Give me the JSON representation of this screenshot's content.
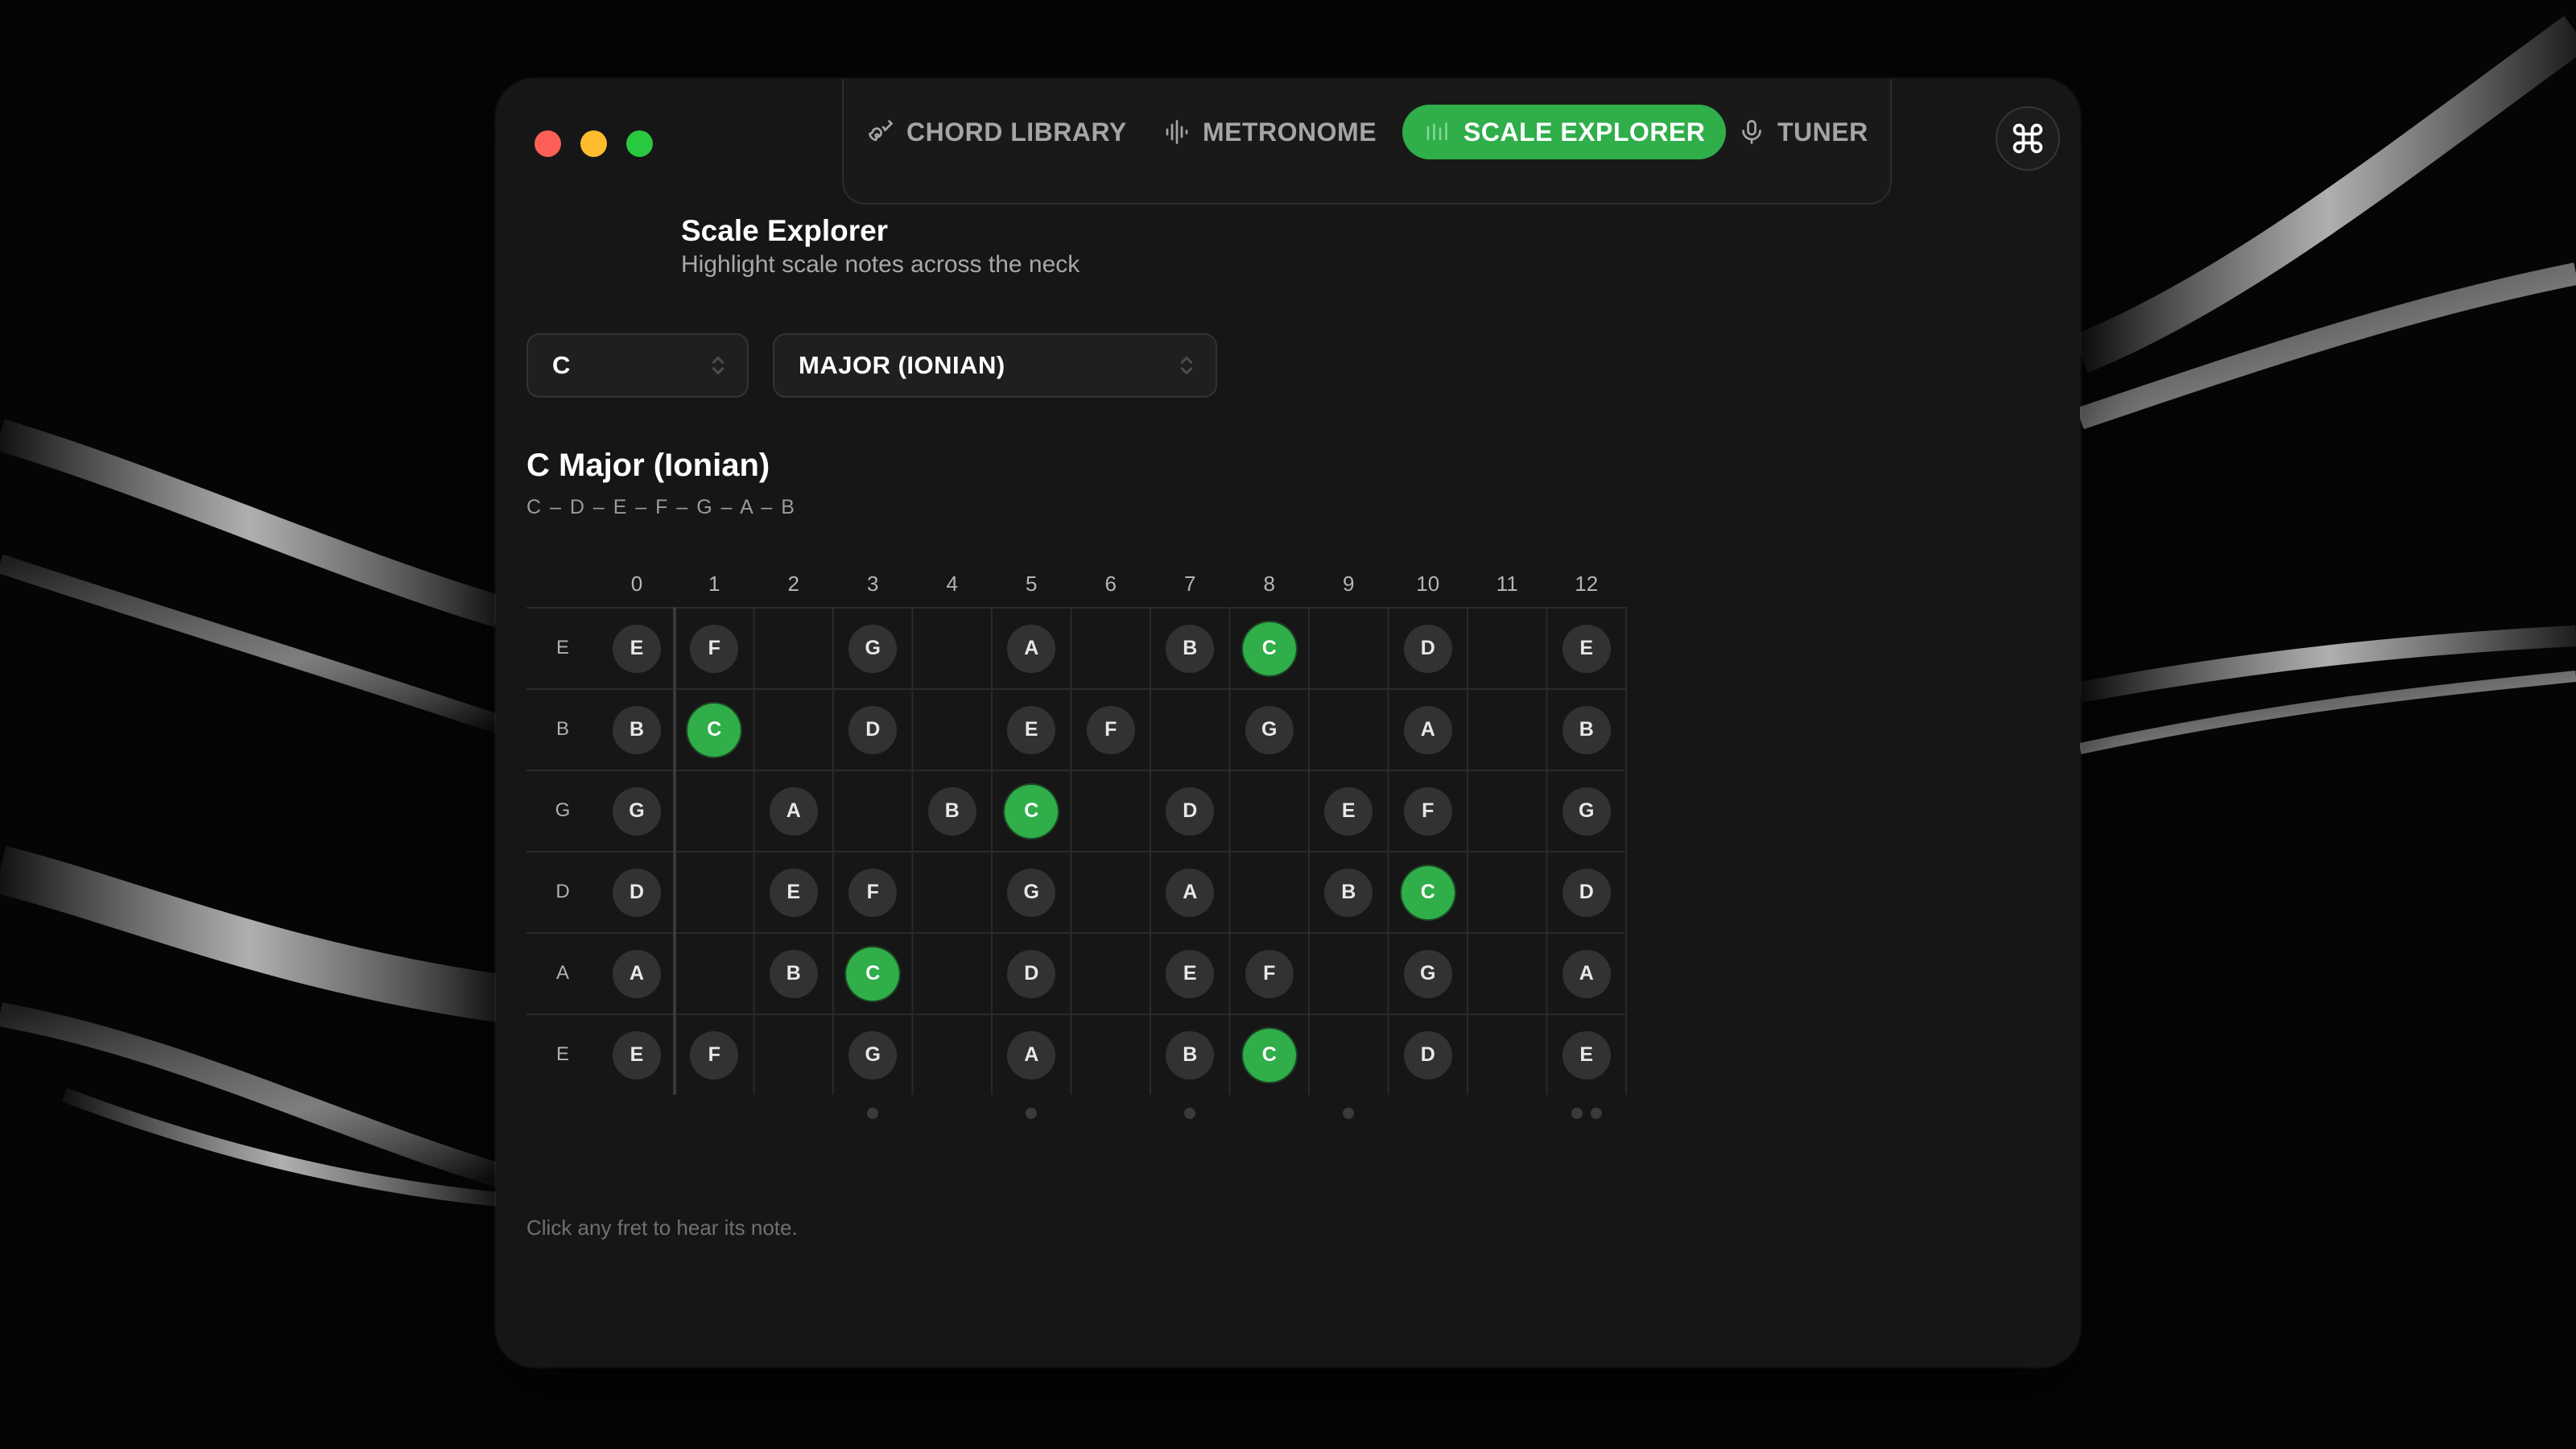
{
  "nav": {
    "tabs": [
      {
        "label": "CHORD LIBRARY",
        "icon": "guitar-icon"
      },
      {
        "label": "METRONOME",
        "icon": "waveform-icon"
      },
      {
        "label": "SCALE EXPLORER",
        "icon": "notes-icon",
        "active": true
      },
      {
        "label": "TUNER",
        "icon": "microphone-icon"
      }
    ],
    "command_icon": "command-key-icon"
  },
  "page": {
    "title": "Scale Explorer",
    "subtitle": "Highlight scale notes across the neck"
  },
  "controls": {
    "key": "C",
    "mode": "MAJOR (IONIAN)"
  },
  "scale": {
    "name": "C Major (Ionian)",
    "notes": "C – D – E – F – G – A – B"
  },
  "fretboard": {
    "frets": [
      "0",
      "1",
      "2",
      "3",
      "4",
      "5",
      "6",
      "7",
      "8",
      "9",
      "10",
      "11",
      "12"
    ],
    "strings": [
      {
        "label": "E",
        "notes": [
          "E",
          "F",
          "",
          "G",
          "",
          "A",
          "",
          "B",
          "C",
          "",
          "D",
          "",
          "E"
        ]
      },
      {
        "label": "B",
        "notes": [
          "B",
          "C",
          "",
          "D",
          "",
          "E",
          "F",
          "",
          "G",
          "",
          "A",
          "",
          "B"
        ]
      },
      {
        "label": "G",
        "notes": [
          "G",
          "",
          "A",
          "",
          "B",
          "C",
          "",
          "D",
          "",
          "E",
          "F",
          "",
          "G"
        ]
      },
      {
        "label": "D",
        "notes": [
          "D",
          "",
          "E",
          "F",
          "",
          "G",
          "",
          "A",
          "",
          "B",
          "C",
          "",
          "D"
        ]
      },
      {
        "label": "A",
        "notes": [
          "A",
          "",
          "B",
          "C",
          "",
          "D",
          "",
          "E",
          "F",
          "",
          "G",
          "",
          "A"
        ]
      },
      {
        "label": "E",
        "notes": [
          "E",
          "F",
          "",
          "G",
          "",
          "A",
          "",
          "B",
          "C",
          "",
          "D",
          "",
          "E"
        ]
      }
    ],
    "root_note": "C",
    "inlay_frets": [
      3,
      5,
      7,
      9,
      12
    ],
    "double_inlay_frets": [
      12
    ]
  },
  "hint": "Click any fret to hear its note.",
  "colors": {
    "accent": "#2fae4a",
    "note_bg": "#323232",
    "window_bg": "#161616"
  }
}
